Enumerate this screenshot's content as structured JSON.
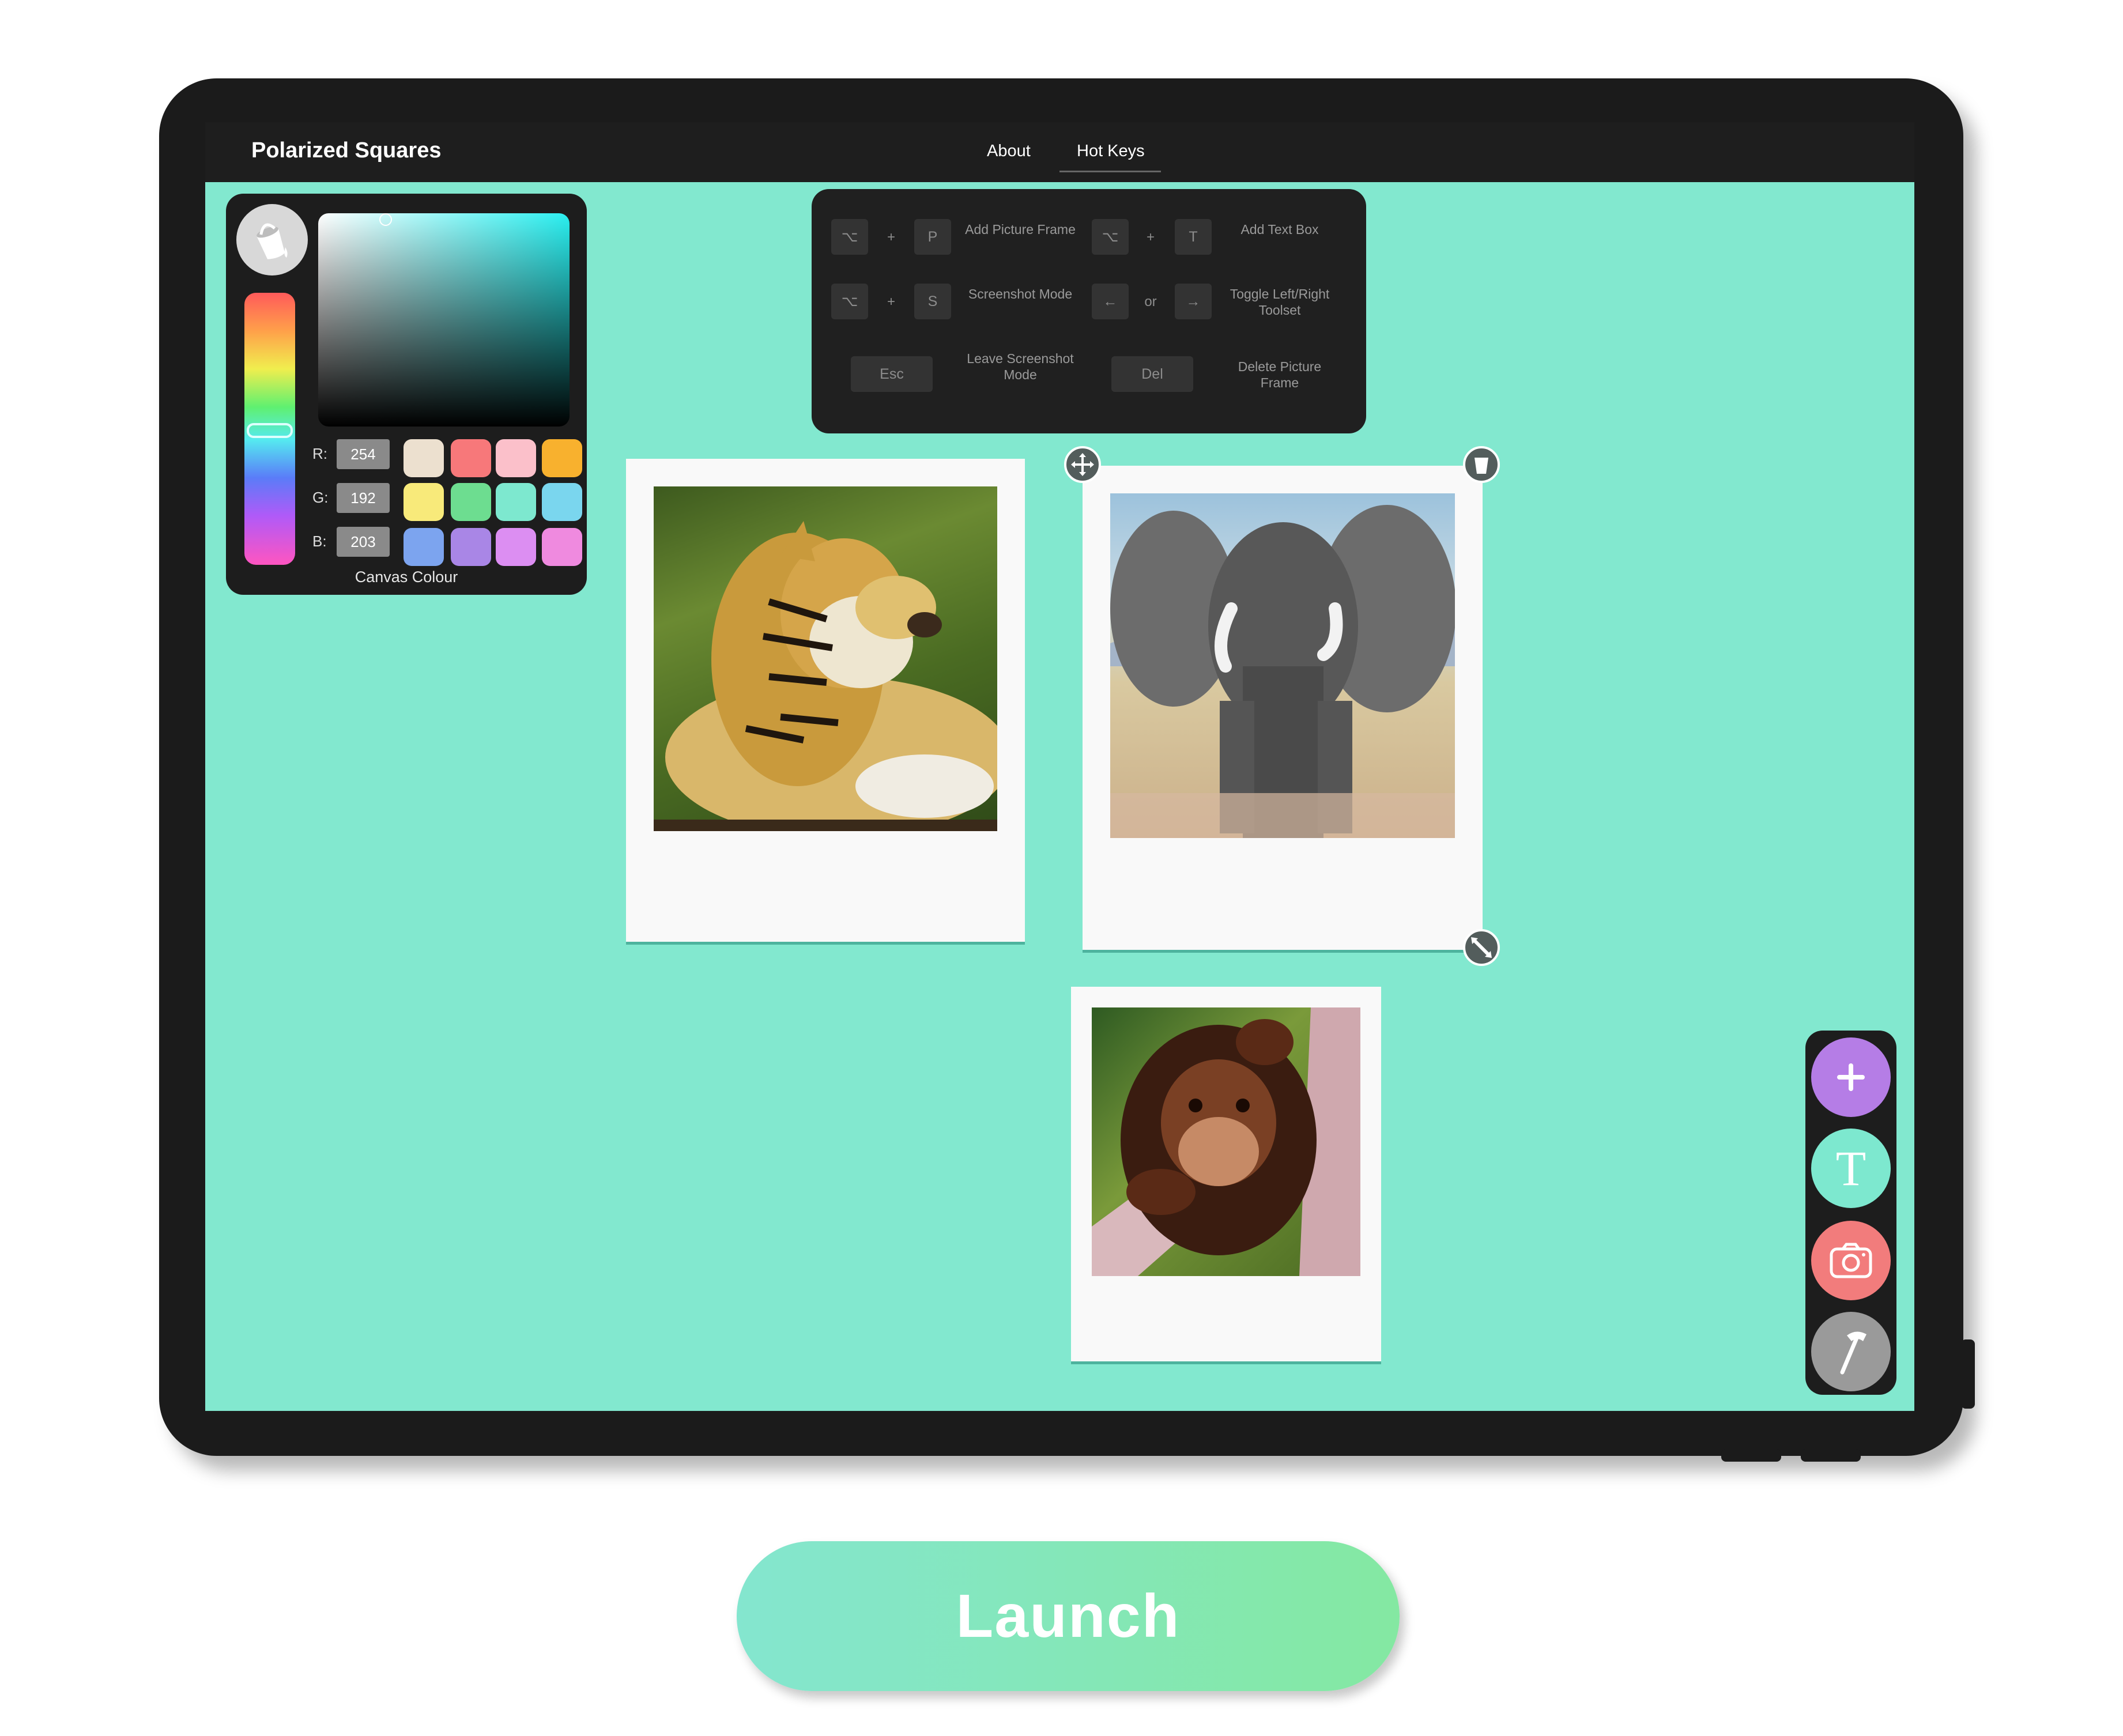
{
  "app": {
    "title": "Polarized Squares"
  },
  "nav": {
    "about": "About",
    "hot_keys": "Hot Keys",
    "active": "Hot Keys"
  },
  "color_panel": {
    "r_label": "R:",
    "g_label": "G:",
    "b_label": "B:",
    "r": "254",
    "g": "192",
    "b": "203",
    "caption": "Canvas Colour",
    "swatches": [
      "#ece0cf",
      "#f7787a",
      "#fbc0ca",
      "#f8b12e",
      "#f8ea7a",
      "#6ddd90",
      "#7de8cf",
      "#7ad6ee",
      "#7ca4ef",
      "#a986e6",
      "#dc8ef2",
      "#ef8adf"
    ],
    "canvas_color": "#82e8cf"
  },
  "hotkeys": {
    "add_picture": {
      "mod": "⌥",
      "plus": "+",
      "key": "P",
      "desc": "Add Picture Frame"
    },
    "add_text": {
      "mod": "⌥",
      "plus": "+",
      "key": "T",
      "desc": "Add Text Box"
    },
    "screenshot": {
      "mod": "⌥",
      "plus": "+",
      "key": "S",
      "desc": "Screenshot Mode"
    },
    "toggle": {
      "left": "←",
      "or": "or",
      "right": "→",
      "desc": "Toggle Left/Right Toolset"
    },
    "leave": {
      "key": "Esc",
      "desc": "Leave Screenshot Mode"
    },
    "delete": {
      "key": "Del",
      "desc": "Delete Picture Frame"
    }
  },
  "frames": [
    {
      "subject": "tiger painting"
    },
    {
      "subject": "elephant painting"
    },
    {
      "subject": "chimpanzee painting"
    }
  ],
  "toolbar": {
    "add_icon": "plus-icon",
    "add_color": "#b57de6",
    "text_icon": "text-icon",
    "text_label": "T",
    "text_color": "#7de8cf",
    "camera_icon": "camera-icon",
    "camera_color": "#f27c7c",
    "hammer_icon": "hammer-icon",
    "hammer_color": "#9a9a9a"
  },
  "launch": {
    "label": "Launch"
  }
}
